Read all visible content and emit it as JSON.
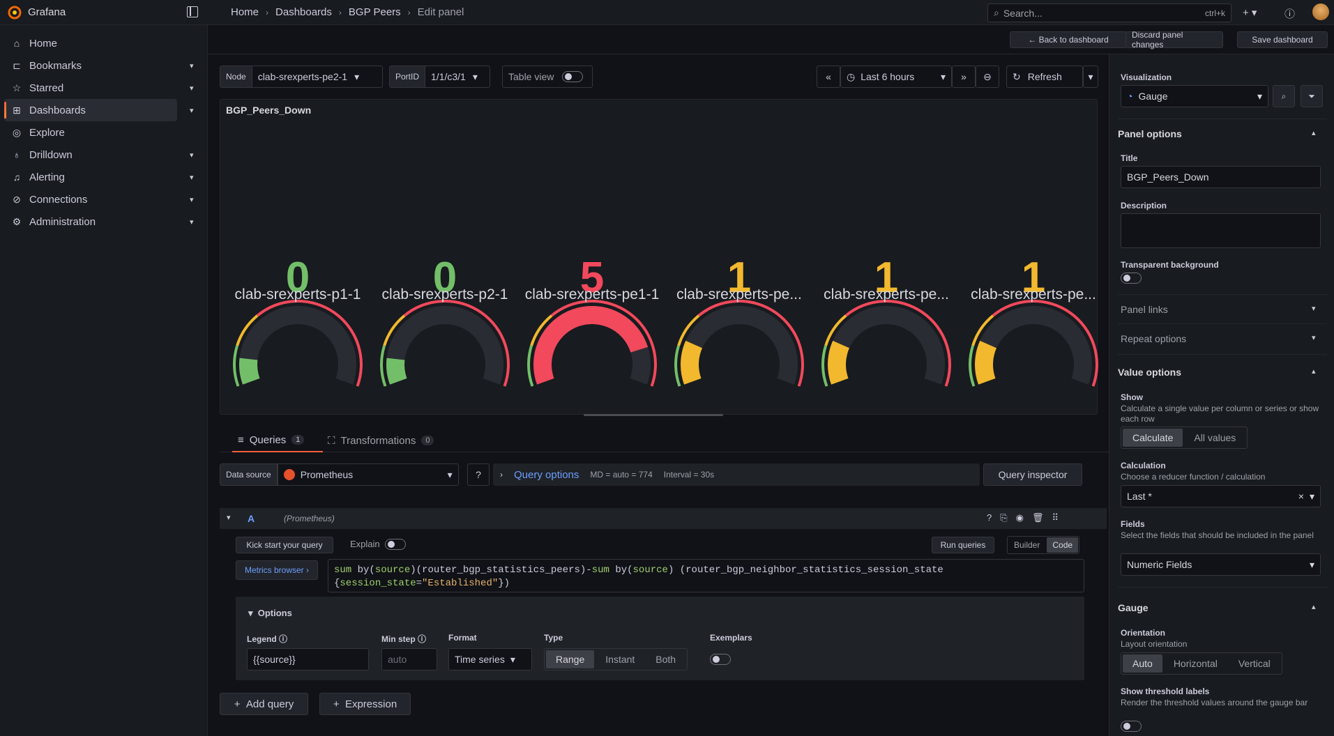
{
  "app": {
    "brand": "Grafana"
  },
  "breadcrumbs": [
    "Home",
    "Dashboards",
    "BGP Peers",
    "Edit panel"
  ],
  "search": {
    "placeholder": "Search...",
    "shortcut": "ctrl+k"
  },
  "nav": [
    {
      "label": "Home",
      "icon": "home-icon"
    },
    {
      "label": "Bookmarks",
      "icon": "bookmark-icon"
    },
    {
      "label": "Starred",
      "icon": "star-icon"
    },
    {
      "label": "Dashboards",
      "icon": "dashboards-icon"
    },
    {
      "label": "Explore",
      "icon": "compass-icon"
    },
    {
      "label": "Drilldown",
      "icon": "drilldown-icon"
    },
    {
      "label": "Alerting",
      "icon": "bell-icon"
    },
    {
      "label": "Connections",
      "icon": "plug-icon"
    },
    {
      "label": "Administration",
      "icon": "gear-icon"
    }
  ],
  "actions": {
    "back": "Back to dashboard",
    "discard": "Discard panel changes",
    "save": "Save dashboard"
  },
  "variables": {
    "node_label": "Node",
    "node_value": "clab-srexperts-pe2-1",
    "port_label": "PortID",
    "port_value": "1/1/c3/1",
    "table_view": "Table view"
  },
  "time": {
    "range": "Last 6 hours",
    "refresh": "Refresh"
  },
  "panel": {
    "title": "BGP_Peers_Down",
    "gauges": [
      {
        "name": "clab-srexperts-p1-1",
        "value": "0",
        "fraction": 0.0,
        "color": "#73bf69"
      },
      {
        "name": "clab-srexperts-p2-1",
        "value": "0",
        "fraction": 0.0,
        "color": "#73bf69"
      },
      {
        "name": "clab-srexperts-pe1-1",
        "value": "5",
        "fraction": 0.83,
        "color": "#f2495c"
      },
      {
        "name": "clab-srexperts-pe...",
        "value": "1",
        "fraction": 0.2,
        "color": "#f2b82e"
      },
      {
        "name": "clab-srexperts-pe...",
        "value": "1",
        "fraction": 0.2,
        "color": "#f2b82e"
      },
      {
        "name": "clab-srexperts-pe...",
        "value": "1",
        "fraction": 0.2,
        "color": "#f2b82e"
      }
    ]
  },
  "tabs": {
    "queries": "Queries",
    "queries_count": "1",
    "transformations": "Transformations",
    "transformations_count": "0"
  },
  "datasource": {
    "label": "Data source",
    "value": "Prometheus",
    "query_options": "Query options",
    "md": "MD = auto = 774",
    "interval": "Interval = 30s",
    "inspector": "Query inspector"
  },
  "query": {
    "ref": "A",
    "source": "(Prometheus)",
    "kickstart": "Kick start your query",
    "explain": "Explain",
    "run": "Run queries",
    "builder": "Builder",
    "code": "Code",
    "metrics_browser": "Metrics browser ›",
    "line1_a": "sum",
    "line1_b": " by(",
    "line1_c": "source",
    "line1_d": ")(router_bgp_statistics_peers)-",
    "line1_e": "sum",
    "line1_f": " by(",
    "line1_g": "source",
    "line1_h": ") (router_bgp_neighbor_statistics_session_state",
    "line2_a": "{",
    "line2_b": "session_state",
    "line2_c": "=",
    "line2_d": "\"Established\"",
    "line2_e": "})"
  },
  "options": {
    "title": "Options",
    "legend_label": "Legend",
    "legend_value": "{{source}}",
    "minstep_label": "Min step",
    "minstep_placeholder": "auto",
    "format_label": "Format",
    "format_value": "Time series",
    "type_label": "Type",
    "type_options": [
      "Range",
      "Instant",
      "Both"
    ],
    "exemplars_label": "Exemplars"
  },
  "add": {
    "query": "Add query",
    "expression": "Expression"
  },
  "right": {
    "viz_label": "Visualization",
    "viz_value": "Gauge",
    "panel_options": "Panel options",
    "title_label": "Title",
    "title_value": "BGP_Peers_Down",
    "description_label": "Description",
    "transparent_label": "Transparent background",
    "panel_links": "Panel links",
    "repeat_options": "Repeat options",
    "value_options": "Value options",
    "show_label": "Show",
    "show_desc": "Calculate a single value per column or series or show each row",
    "show_options": [
      "Calculate",
      "All values"
    ],
    "calc_label": "Calculation",
    "calc_desc": "Choose a reducer function / calculation",
    "calc_value": "Last *",
    "fields_label": "Fields",
    "fields_desc": "Select the fields that should be included in the panel",
    "fields_value": "Numeric Fields",
    "gauge": "Gauge",
    "orientation_label": "Orientation",
    "orientation_desc": "Layout orientation",
    "orientation_options": [
      "Auto",
      "Horizontal",
      "Vertical"
    ],
    "threshold_label": "Show threshold labels",
    "threshold_desc": "Render the threshold values around the gauge bar"
  }
}
